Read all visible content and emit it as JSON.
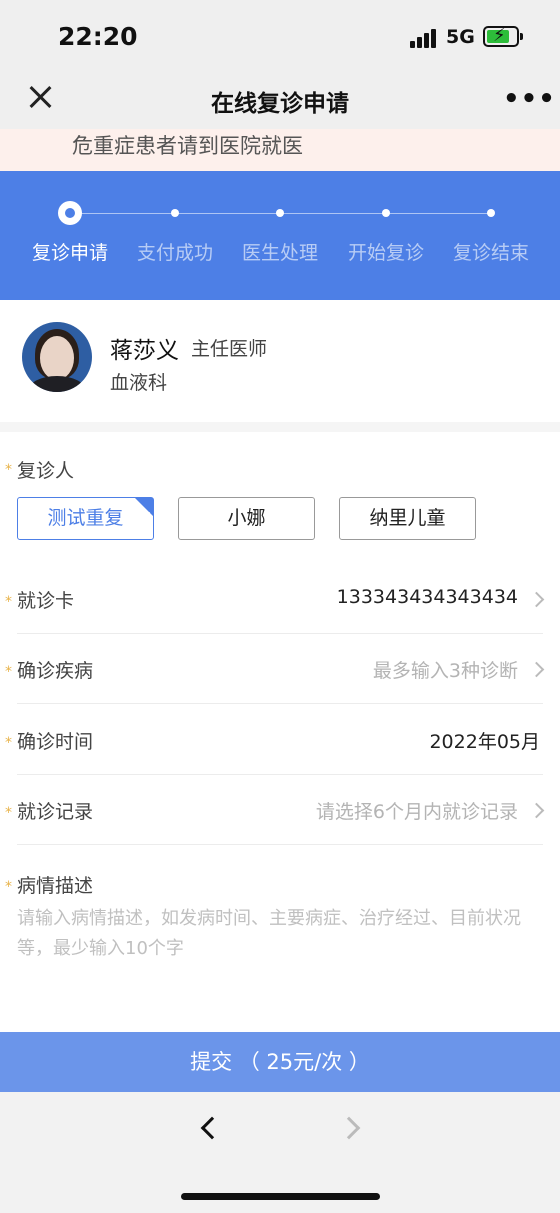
{
  "status": {
    "time": "22:20",
    "network": "5G",
    "battery_icon": "battery-charging-icon",
    "signal_icon": "signal-bars-icon"
  },
  "nav": {
    "title": "在线复诊申请",
    "close_icon": "close-icon",
    "more_icon": "more-dots-icon",
    "more": "•••"
  },
  "notice": {
    "text": "危重症患者请到医院就医"
  },
  "steps": [
    {
      "label": "复诊申请",
      "active": true
    },
    {
      "label": "支付成功",
      "active": false
    },
    {
      "label": "医生处理",
      "active": false
    },
    {
      "label": "开始复诊",
      "active": false
    },
    {
      "label": "复诊结束",
      "active": false
    }
  ],
  "doctor": {
    "name": "蒋莎义",
    "title": "主任医师",
    "department": "血液科"
  },
  "form": {
    "patient": {
      "label": "复诊人",
      "options": [
        {
          "label": "测试重复",
          "selected": true
        },
        {
          "label": "小娜",
          "selected": false
        },
        {
          "label": "纳里儿童",
          "selected": false
        }
      ]
    },
    "card": {
      "label": "就诊卡",
      "value": "133343434343434"
    },
    "disease": {
      "label": "确诊疾病",
      "placeholder": "最多输入3种诊断"
    },
    "diagnosis_time": {
      "label": "确诊时间",
      "value": "2022年05月"
    },
    "record": {
      "label": "就诊记录",
      "placeholder": "请选择6个月内就诊记录"
    },
    "description": {
      "label": "病情描述",
      "placeholder": "请输入病情描述，如发病时间、主要病症、治疗经过、目前状况等，最少输入10个字"
    },
    "required_mark": "*"
  },
  "submit": {
    "label": "提交  （ 25元/次 ）"
  },
  "browser": {
    "back_icon": "back-arrow-icon",
    "forward_icon": "forward-arrow-icon"
  },
  "colors": {
    "primary": "#4d7fe6",
    "submit": "#6b95ea",
    "required": "#e8b34a"
  }
}
